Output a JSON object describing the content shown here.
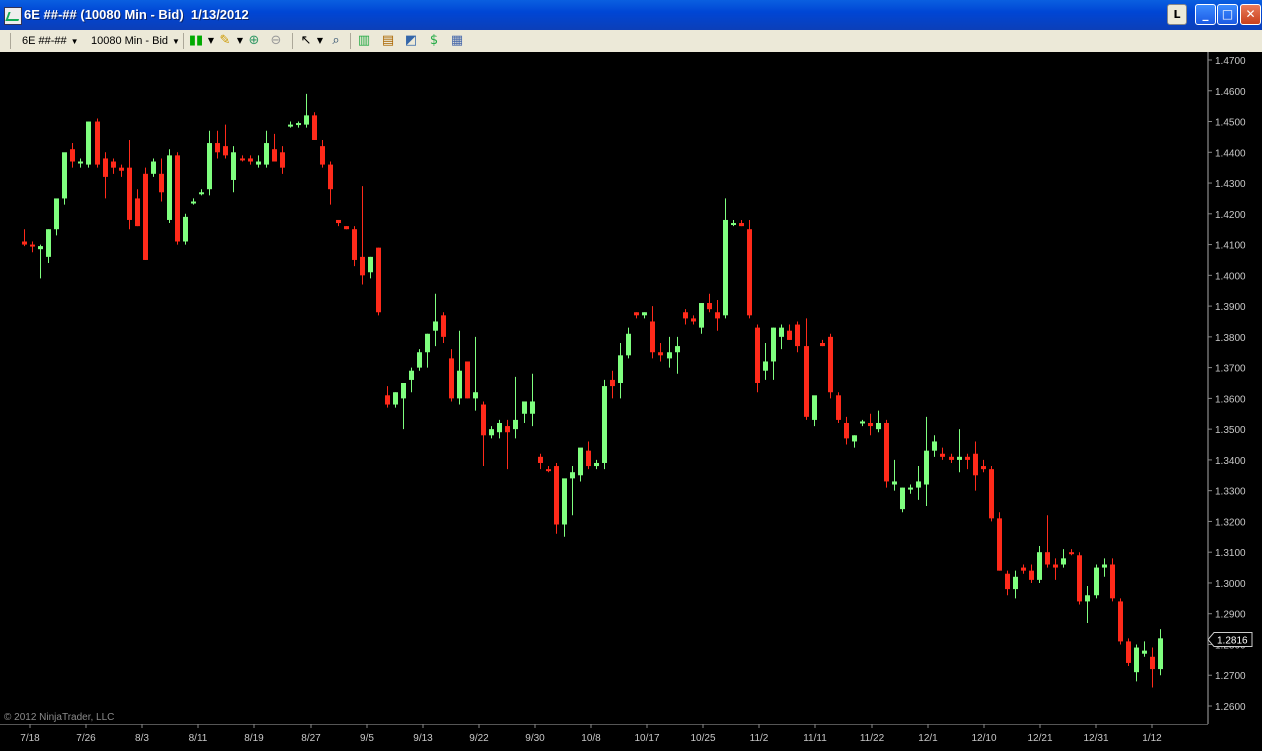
{
  "window": {
    "title": "6E ##-## (10080 Min - Bid)  1/13/2012",
    "lock_button": "L",
    "minimize_label": "_",
    "maximize_label": "□",
    "close_label": "✕"
  },
  "toolbar": {
    "instrument": "6E ##-##",
    "period": "10080 Min - Bid"
  },
  "copyright": "© 2012 NinjaTrader, LLC",
  "colors": {
    "up": "#7fff7f",
    "down": "#ff2a1a",
    "background": "#000000",
    "axis_text": "#c8c8c8"
  },
  "chart_data": {
    "type": "candlestick",
    "title": "",
    "xlabel": "",
    "ylabel": "",
    "ylim": [
      1.255,
      1.47
    ],
    "y_ticks": [
      "1.4700",
      "1.4600",
      "1.4500",
      "1.4400",
      "1.4300",
      "1.4200",
      "1.4100",
      "1.4000",
      "1.3900",
      "1.3800",
      "1.3700",
      "1.3600",
      "1.3500",
      "1.3400",
      "1.3300",
      "1.3200",
      "1.3100",
      "1.3000",
      "1.2900",
      "1.2800",
      "1.2700",
      "1.2600"
    ],
    "x_ticks": [
      "7/18",
      "7/26",
      "8/3",
      "8/11",
      "8/19",
      "8/27",
      "9/5",
      "9/13",
      "9/22",
      "9/30",
      "10/8",
      "10/17",
      "10/25",
      "11/2",
      "11/11",
      "11/22",
      "12/1",
      "12/10",
      "12/21",
      "12/31",
      "1/12"
    ],
    "last_price": "1.2816",
    "grid": false,
    "candles": [
      [
        1.411,
        1.415,
        1.4095,
        1.41
      ],
      [
        1.41,
        1.411,
        1.4075,
        1.4095
      ],
      [
        1.4085,
        1.41,
        1.399,
        1.4095
      ],
      [
        1.406,
        1.415,
        1.404,
        1.415
      ],
      [
        1.415,
        1.421,
        1.413,
        1.425
      ],
      [
        1.425,
        1.438,
        1.423,
        1.44
      ],
      [
        1.441,
        1.443,
        1.435,
        1.437
      ],
      [
        1.437,
        1.438,
        1.435,
        1.437
      ],
      [
        1.436,
        1.45,
        1.435,
        1.45
      ],
      [
        1.45,
        1.451,
        1.435,
        1.436
      ],
      [
        1.438,
        1.44,
        1.425,
        1.432
      ],
      [
        1.437,
        1.438,
        1.433,
        1.435
      ],
      [
        1.435,
        1.436,
        1.432,
        1.434
      ],
      [
        1.435,
        1.444,
        1.415,
        1.418
      ],
      [
        1.425,
        1.428,
        1.416,
        1.416
      ],
      [
        1.433,
        1.435,
        1.405,
        1.405
      ],
      [
        1.433,
        1.438,
        1.432,
        1.437
      ],
      [
        1.433,
        1.438,
        1.424,
        1.427
      ],
      [
        1.418,
        1.441,
        1.417,
        1.439
      ],
      [
        1.439,
        1.44,
        1.41,
        1.411
      ],
      [
        1.411,
        1.42,
        1.41,
        1.419
      ],
      [
        1.424,
        1.425,
        1.423,
        1.424
      ],
      [
        1.427,
        1.428,
        1.426,
        1.427
      ],
      [
        1.428,
        1.447,
        1.426,
        1.443
      ],
      [
        1.443,
        1.447,
        1.438,
        1.44
      ],
      [
        1.442,
        1.449,
        1.438,
        1.439
      ],
      [
        1.431,
        1.442,
        1.427,
        1.44
      ],
      [
        1.438,
        1.439,
        1.437,
        1.4375
      ],
      [
        1.438,
        1.439,
        1.436,
        1.437
      ],
      [
        1.436,
        1.439,
        1.435,
        1.437
      ],
      [
        1.436,
        1.447,
        1.435,
        1.443
      ],
      [
        1.441,
        1.446,
        1.439,
        1.437
      ],
      [
        1.44,
        1.442,
        1.433,
        1.435
      ],
      [
        1.449,
        1.45,
        1.448,
        1.449
      ],
      [
        1.449,
        1.45,
        1.448,
        1.4495
      ],
      [
        1.449,
        1.459,
        1.448,
        1.452
      ],
      [
        1.452,
        1.453,
        1.444,
        1.444
      ],
      [
        1.442,
        1.444,
        1.435,
        1.436
      ],
      [
        1.436,
        1.437,
        1.423,
        1.428
      ],
      [
        1.418,
        1.418,
        1.416,
        1.417
      ],
      [
        1.416,
        1.416,
        1.415,
        1.415
      ],
      [
        1.415,
        1.416,
        1.403,
        1.405
      ],
      [
        1.406,
        1.429,
        1.397,
        1.4
      ],
      [
        1.401,
        1.406,
        1.399,
        1.406
      ],
      [
        1.409,
        1.409,
        1.387,
        1.388
      ],
      [
        1.361,
        1.364,
        1.357,
        1.358
      ],
      [
        1.358,
        1.362,
        1.357,
        1.362
      ],
      [
        1.36,
        1.365,
        1.35,
        1.365
      ],
      [
        1.366,
        1.37,
        1.362,
        1.369
      ],
      [
        1.37,
        1.376,
        1.369,
        1.375
      ],
      [
        1.375,
        1.381,
        1.37,
        1.381
      ],
      [
        1.382,
        1.394,
        1.377,
        1.385
      ],
      [
        1.387,
        1.388,
        1.378,
        1.38
      ],
      [
        1.373,
        1.376,
        1.359,
        1.36
      ],
      [
        1.36,
        1.382,
        1.358,
        1.369
      ],
      [
        1.372,
        1.372,
        1.36,
        1.36
      ],
      [
        1.36,
        1.38,
        1.356,
        1.362
      ],
      [
        1.358,
        1.359,
        1.338,
        1.348
      ],
      [
        1.348,
        1.351,
        1.347,
        1.35
      ],
      [
        1.349,
        1.353,
        1.347,
        1.352
      ],
      [
        1.351,
        1.353,
        1.337,
        1.349
      ],
      [
        1.35,
        1.367,
        1.347,
        1.353
      ],
      [
        1.355,
        1.359,
        1.352,
        1.359
      ],
      [
        1.355,
        1.368,
        1.351,
        1.359
      ],
      [
        1.341,
        1.342,
        1.337,
        1.339
      ],
      [
        1.337,
        1.338,
        1.336,
        1.3365
      ],
      [
        1.338,
        1.339,
        1.316,
        1.319
      ],
      [
        1.319,
        1.333,
        1.315,
        1.334
      ],
      [
        1.334,
        1.338,
        1.322,
        1.336
      ],
      [
        1.335,
        1.343,
        1.333,
        1.344
      ],
      [
        1.343,
        1.346,
        1.337,
        1.338
      ],
      [
        1.338,
        1.34,
        1.337,
        1.339
      ],
      [
        1.339,
        1.366,
        1.337,
        1.364
      ],
      [
        1.366,
        1.369,
        1.36,
        1.364
      ],
      [
        1.365,
        1.378,
        1.36,
        1.374
      ],
      [
        1.374,
        1.383,
        1.373,
        1.381
      ],
      [
        1.388,
        1.388,
        1.386,
        1.387
      ],
      [
        1.387,
        1.388,
        1.386,
        1.388
      ],
      [
        1.385,
        1.39,
        1.373,
        1.375
      ],
      [
        1.375,
        1.378,
        1.372,
        1.374
      ],
      [
        1.373,
        1.38,
        1.37,
        1.375
      ],
      [
        1.375,
        1.38,
        1.368,
        1.377
      ],
      [
        1.388,
        1.389,
        1.384,
        1.386
      ],
      [
        1.386,
        1.387,
        1.384,
        1.385
      ],
      [
        1.383,
        1.391,
        1.381,
        1.391
      ],
      [
        1.391,
        1.394,
        1.388,
        1.389
      ],
      [
        1.388,
        1.392,
        1.382,
        1.386
      ],
      [
        1.387,
        1.425,
        1.386,
        1.418
      ],
      [
        1.417,
        1.418,
        1.416,
        1.417
      ],
      [
        1.417,
        1.418,
        1.416,
        1.416
      ],
      [
        1.415,
        1.418,
        1.386,
        1.387
      ],
      [
        1.383,
        1.384,
        1.362,
        1.365
      ],
      [
        1.369,
        1.378,
        1.366,
        1.372
      ],
      [
        1.372,
        1.383,
        1.366,
        1.383
      ],
      [
        1.38,
        1.384,
        1.376,
        1.383
      ],
      [
        1.382,
        1.384,
        1.379,
        1.379
      ],
      [
        1.384,
        1.385,
        1.375,
        1.377
      ],
      [
        1.377,
        1.386,
        1.353,
        1.354
      ],
      [
        1.353,
        1.359,
        1.351,
        1.361
      ],
      [
        1.378,
        1.379,
        1.377,
        1.377
      ],
      [
        1.38,
        1.381,
        1.36,
        1.362
      ],
      [
        1.361,
        1.362,
        1.352,
        1.353
      ],
      [
        1.352,
        1.354,
        1.345,
        1.347
      ],
      [
        1.346,
        1.348,
        1.344,
        1.348
      ],
      [
        1.352,
        1.353,
        1.351,
        1.3525
      ],
      [
        1.352,
        1.355,
        1.348,
        1.351
      ],
      [
        1.35,
        1.356,
        1.349,
        1.352
      ],
      [
        1.352,
        1.353,
        1.331,
        1.333
      ],
      [
        1.332,
        1.34,
        1.33,
        1.333
      ],
      [
        1.324,
        1.331,
        1.323,
        1.331
      ],
      [
        1.331,
        1.332,
        1.329,
        1.331
      ],
      [
        1.331,
        1.338,
        1.327,
        1.333
      ],
      [
        1.332,
        1.354,
        1.325,
        1.343
      ],
      [
        1.343,
        1.348,
        1.341,
        1.346
      ],
      [
        1.342,
        1.344,
        1.34,
        1.341
      ],
      [
        1.341,
        1.342,
        1.339,
        1.34
      ],
      [
        1.34,
        1.35,
        1.336,
        1.341
      ],
      [
        1.341,
        1.342,
        1.337,
        1.34
      ],
      [
        1.342,
        1.346,
        1.33,
        1.335
      ],
      [
        1.338,
        1.34,
        1.336,
        1.337
      ],
      [
        1.337,
        1.338,
        1.32,
        1.321
      ],
      [
        1.321,
        1.323,
        1.304,
        1.304
      ],
      [
        1.303,
        1.304,
        1.296,
        1.298
      ],
      [
        1.298,
        1.304,
        1.295,
        1.302
      ],
      [
        1.305,
        1.306,
        1.303,
        1.304
      ],
      [
        1.304,
        1.306,
        1.3,
        1.301
      ],
      [
        1.301,
        1.312,
        1.3,
        1.31
      ],
      [
        1.31,
        1.322,
        1.305,
        1.306
      ],
      [
        1.306,
        1.308,
        1.301,
        1.305
      ],
      [
        1.306,
        1.311,
        1.305,
        1.308
      ],
      [
        1.31,
        1.311,
        1.309,
        1.3095
      ],
      [
        1.309,
        1.31,
        1.293,
        1.294
      ],
      [
        1.294,
        1.299,
        1.287,
        1.296
      ],
      [
        1.296,
        1.306,
        1.295,
        1.305
      ],
      [
        1.305,
        1.308,
        1.302,
        1.306
      ],
      [
        1.306,
        1.308,
        1.294,
        1.295
      ],
      [
        1.294,
        1.295,
        1.28,
        1.281
      ],
      [
        1.281,
        1.282,
        1.273,
        1.274
      ],
      [
        1.271,
        1.28,
        1.268,
        1.279
      ],
      [
        1.277,
        1.281,
        1.276,
        1.278
      ],
      [
        1.276,
        1.279,
        1.266,
        1.272
      ],
      [
        1.272,
        1.285,
        1.27,
        1.282
      ]
    ]
  }
}
